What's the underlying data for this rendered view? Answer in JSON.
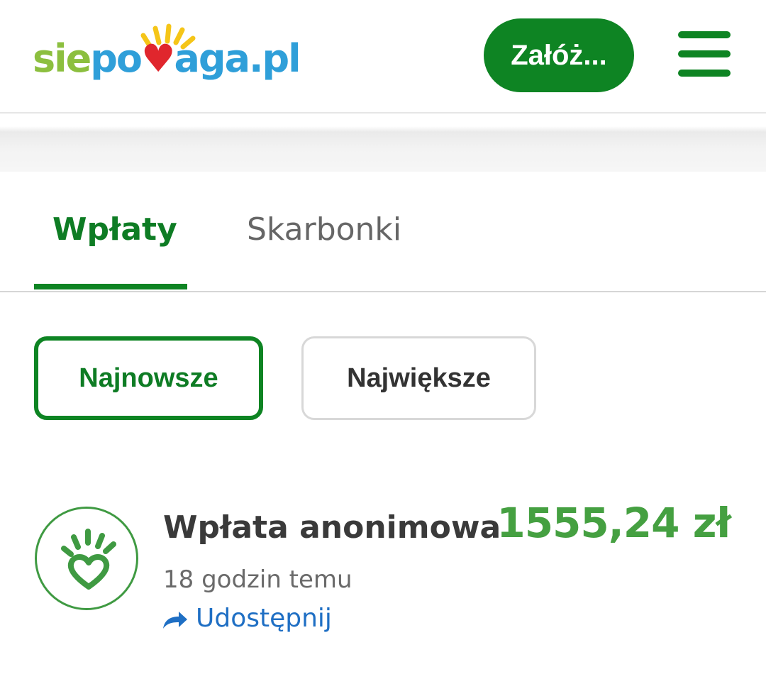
{
  "header": {
    "logo": {
      "part1": "sie",
      "part2": "po",
      "part3": "aga.pl",
      "full_text": "siepomaga.pl"
    },
    "create_button_label": "Załóż...",
    "menu_icon": "hamburger-menu-icon"
  },
  "tabs": [
    {
      "label": "Wpłaty",
      "active": true
    },
    {
      "label": "Skarbonki",
      "active": false
    }
  ],
  "filters": [
    {
      "label": "Najnowsze",
      "active": true
    },
    {
      "label": "Największe",
      "active": false
    }
  ],
  "donations": [
    {
      "donor": "Wpłata anonimowa",
      "time": "18 godzin temu",
      "amount": "1555,24 zł",
      "share_label": "Udostępnij",
      "avatar_icon": "hand-heart-icon",
      "share_icon": "share-arrow-icon"
    }
  ],
  "colors": {
    "brand_green": "#0e8423",
    "amount_green": "#45a041",
    "link_blue": "#1f6fc4",
    "logo_green": "#8cbf3f",
    "logo_blue": "#2f9fd9",
    "logo_red": "#e0262d",
    "logo_yellow": "#f5c518"
  }
}
